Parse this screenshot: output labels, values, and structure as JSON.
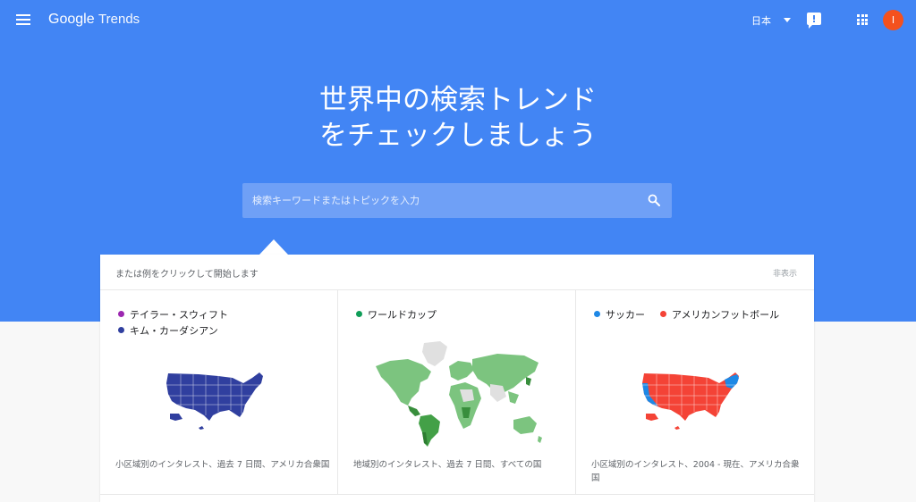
{
  "header": {
    "logo_google": "Google",
    "logo_trends": "Trends",
    "language": "日本",
    "avatar_initial": "I"
  },
  "hero": {
    "title_line1": "世界中の検索トレンド",
    "title_line2": "をチェックしましょう"
  },
  "search": {
    "placeholder": "検索キーワードまたはトピックを入力"
  },
  "examples": {
    "title": "または例をクリックして開始します",
    "hide_label": "非表示",
    "cards": [
      {
        "legend": [
          {
            "label": "テイラー・スウィフト",
            "color": "#9c27b0"
          },
          {
            "label": "キム・カーダシアン",
            "color": "#303f9f"
          }
        ],
        "footnote": "小区域別のインタレスト、過去 7 日間、アメリカ合衆国",
        "map_type": "usa-map-icon",
        "map_color": "#303f9f"
      },
      {
        "legend": [
          {
            "label": "ワールドカップ",
            "color": "#0f9d58"
          }
        ],
        "footnote": "地域別のインタレスト、過去 7 日間、すべての国",
        "map_type": "world-map-icon",
        "map_color": "#7cc47f"
      },
      {
        "legend": [
          {
            "label": "サッカー",
            "color": "#1e88e5"
          },
          {
            "label": "アメリカンフットボール",
            "color": "#f44336"
          }
        ],
        "footnote": "小区域別のインタレスト、2004 - 現在、アメリカ合衆国",
        "map_type": "usa-map-icon",
        "map_color": "#f44336",
        "map_secondary_color": "#1e88e5"
      }
    ]
  }
}
